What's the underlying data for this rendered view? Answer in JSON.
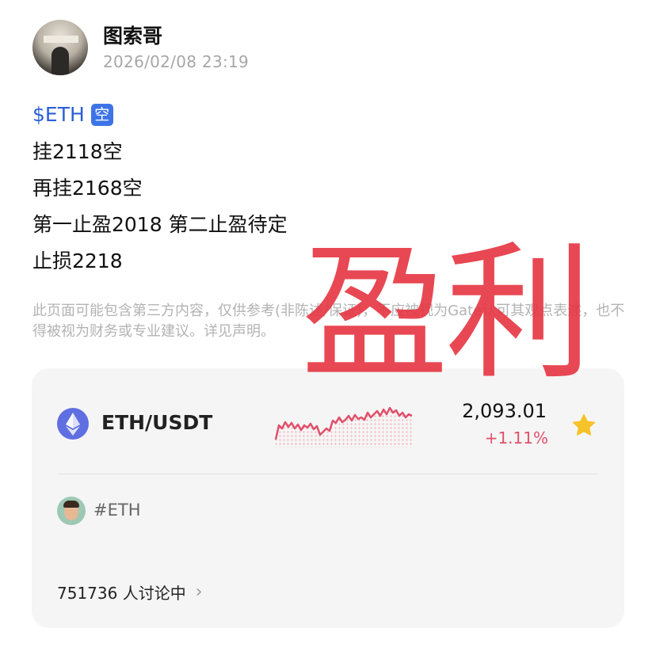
{
  "post": {
    "author": "图索哥",
    "timestamp": "2026/02/08 23:19",
    "ticker": "$ETH",
    "ticker_badge": "空",
    "lines": [
      "挂2118空",
      "再挂2168空",
      "第一止盈2018 第二止盈待定",
      "止损2218"
    ],
    "disclaimer": "此页面可能包含第三方内容，仅供参考(非陈述/保证)，不应被视为Gate认可其观点表述，也不得被视为财务或专业建议。详见声明。",
    "stamp_text": "盈利"
  },
  "market_card": {
    "pair": "ETH/USDT",
    "price": "2,093.01",
    "change": "+1.11%",
    "change_color": "#e0506a",
    "favorite_icon": "star-icon",
    "favorite_color": "#f5c228",
    "topic": "#ETH",
    "discussion_count_text": "751736 人讨论中",
    "chevron": "›"
  },
  "colors": {
    "ticker": "#2a5fd6",
    "stamp": "#e53440",
    "card_bg": "#f5f5f5"
  }
}
